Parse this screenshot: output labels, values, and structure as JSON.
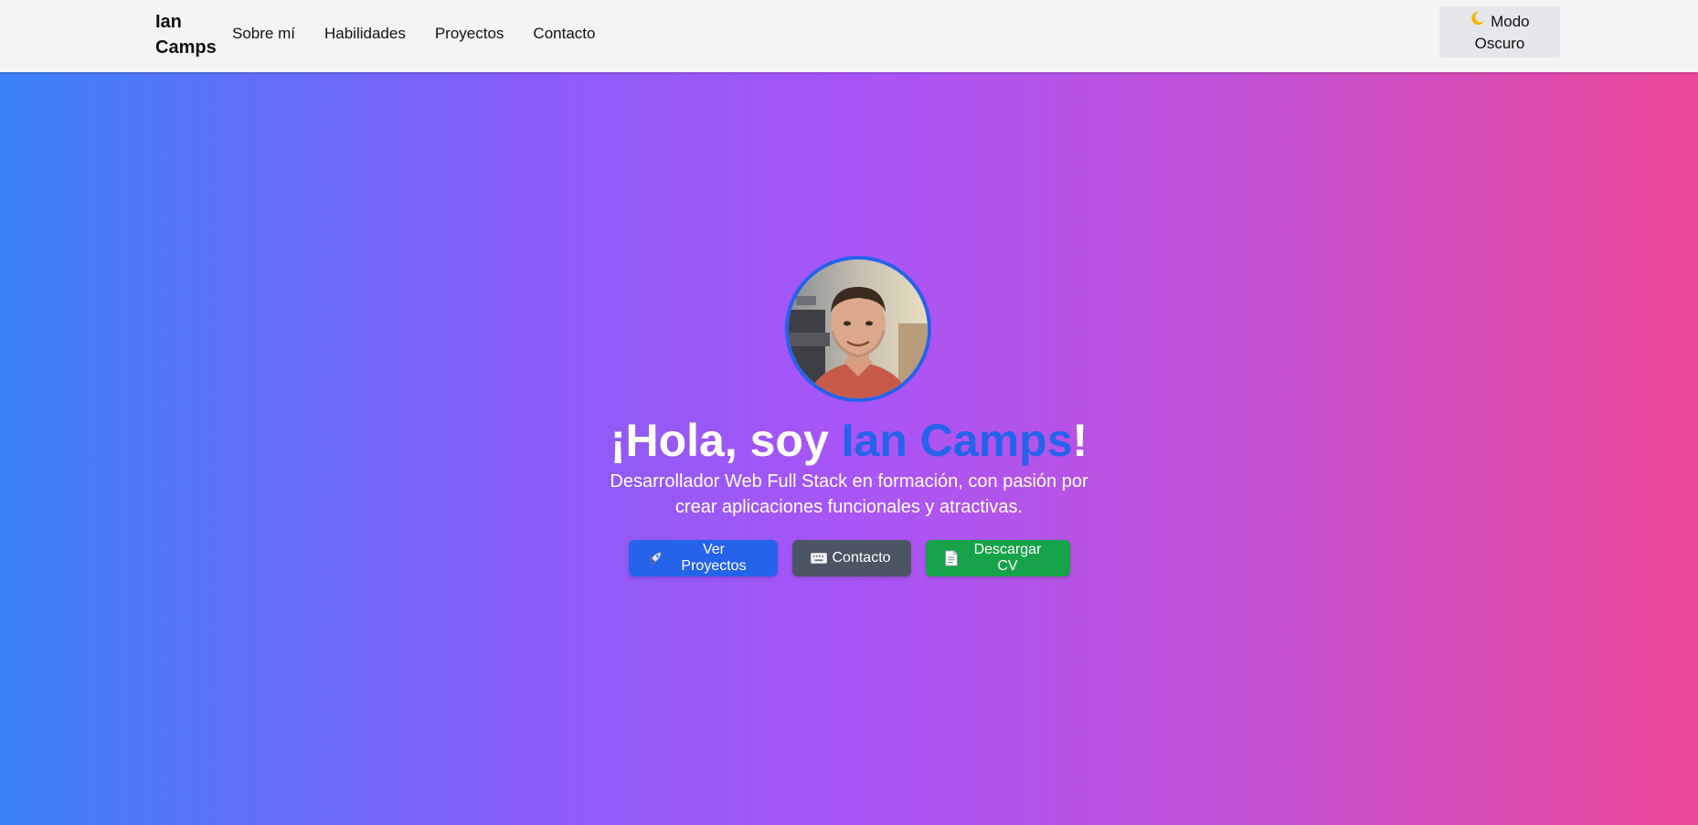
{
  "navbar": {
    "brand": "Ian Camps",
    "links": [
      "Sobre mí",
      "Habilidades",
      "Proyectos",
      "Contacto"
    ],
    "dark_mode_toggle": "Modo Oscuro",
    "dark_mode_icon": "moon-icon"
  },
  "hero": {
    "headline_prefix": "¡Hola, soy ",
    "headline_name": "Ian Camps",
    "headline_suffix": "!",
    "subtitle": "Desarrollador Web Full Stack en formación, con pasión por crear aplicaciones funcionales y atractivas.",
    "buttons": [
      {
        "label": "Ver Proyectos",
        "icon": "rocket-icon",
        "color": "#2563eb"
      },
      {
        "label": "Contacto",
        "icon": "keyboard-icon",
        "color": "#4b5563"
      },
      {
        "label": "Descargar CV",
        "icon": "document-icon",
        "color": "#16a34a"
      }
    ]
  },
  "colors": {
    "gradient_start": "#3b82f6",
    "gradient_mid": "#a855f7",
    "gradient_end": "#ec4899",
    "accent": "#2563eb",
    "navbar_bg": "#f3f4f6"
  }
}
